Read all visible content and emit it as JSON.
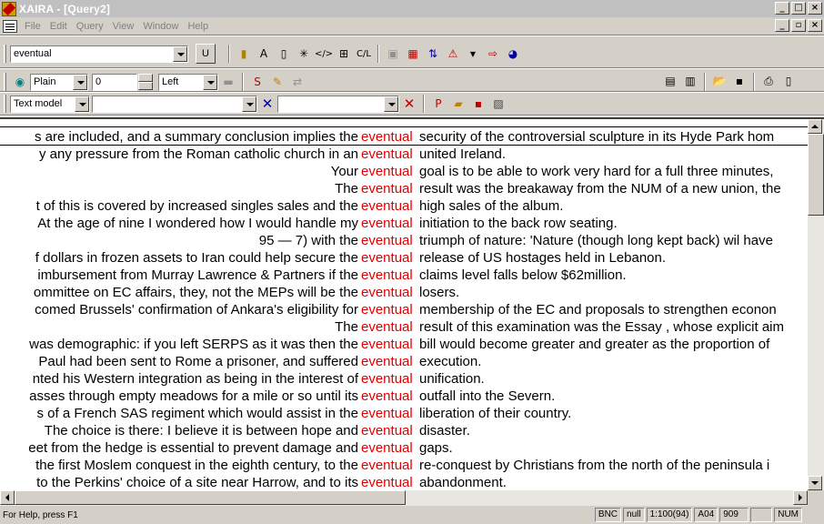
{
  "window": {
    "title": "XAIRA - [Query2]"
  },
  "menu": [
    "File",
    "Edit",
    "Query",
    "View",
    "Window",
    "Help"
  ],
  "toolbar1": {
    "search_value": "eventual",
    "u_button": "U"
  },
  "toolbar2": {
    "format_value": "Plain",
    "number_value": "0",
    "align_value": "Left"
  },
  "toolbar3": {
    "mode_value": "Text model",
    "combo2_value": "",
    "combo3_value": ""
  },
  "concordance": {
    "keyword": "eventual",
    "lines": [
      {
        "left": "s are included, and a summary conclusion implies the",
        "right": "security of the controversial sculpture in its Hyde Park hom"
      },
      {
        "left": "y any pressure from the Roman catholic church in an",
        "right": "united Ireland."
      },
      {
        "left": "Your",
        "right": "goal is to be able to work very hard for a full three minutes,"
      },
      {
        "left": "The",
        "right": "result was the breakaway from the NUM of a new union, the"
      },
      {
        "left": "t of this is covered by increased singles sales and the",
        "right": "high sales of the album."
      },
      {
        "left": "At the age of nine I wondered how I would handle my",
        "right": "initiation to the back row seating."
      },
      {
        "left": "95 — 7) with the",
        "right": "triumph of nature: 'Nature (though long kept back) wil have"
      },
      {
        "left": "f dollars in frozen assets to Iran could help secure the",
        "right": "release of US hostages held in Lebanon."
      },
      {
        "left": "imbursement from Murray Lawrence & Partners if the",
        "right": "claims level falls below $62million."
      },
      {
        "left": "ommittee on EC affairs, they, not the MEPs will be the",
        "right": "losers."
      },
      {
        "left": "comed Brussels' confirmation of Ankara's eligibility for",
        "right": "membership of the EC and proposals to strengthen econon"
      },
      {
        "left": "The",
        "right": "result of this examination was the Essay , whose explicit aim"
      },
      {
        "left": "was demographic: if you left SERPS as it was then the",
        "right": "bill would become greater and greater as the proportion of"
      },
      {
        "left": "Paul had been sent to Rome a prisoner, and suffered",
        "right": "execution."
      },
      {
        "left": "nted his Western integration as being in the interest of",
        "right": "unification."
      },
      {
        "left": "asses through empty meadows for a mile or so until its",
        "right": "outfall into the Severn."
      },
      {
        "left": "s of a French SAS regiment which would assist in the",
        "right": "liberation of their country."
      },
      {
        "left": "The choice is there: I believe it is between hope and",
        "right": "disaster."
      },
      {
        "left": "eet from the hedge is essential to prevent damage and",
        "right": "gaps."
      },
      {
        "left": "the first Moslem conquest in the eighth century, to the",
        "right": "re-conquest by Christians from the north of the peninsula i"
      },
      {
        "left": "to the Perkins' choice of a site near Harrow, and to its",
        "right": "abandonment."
      }
    ]
  },
  "statusbar": {
    "message": "For Help, press F1",
    "panes": [
      "BNC",
      "null",
      "1:100(94)",
      "A04",
      "909",
      "",
      "NUM"
    ]
  }
}
